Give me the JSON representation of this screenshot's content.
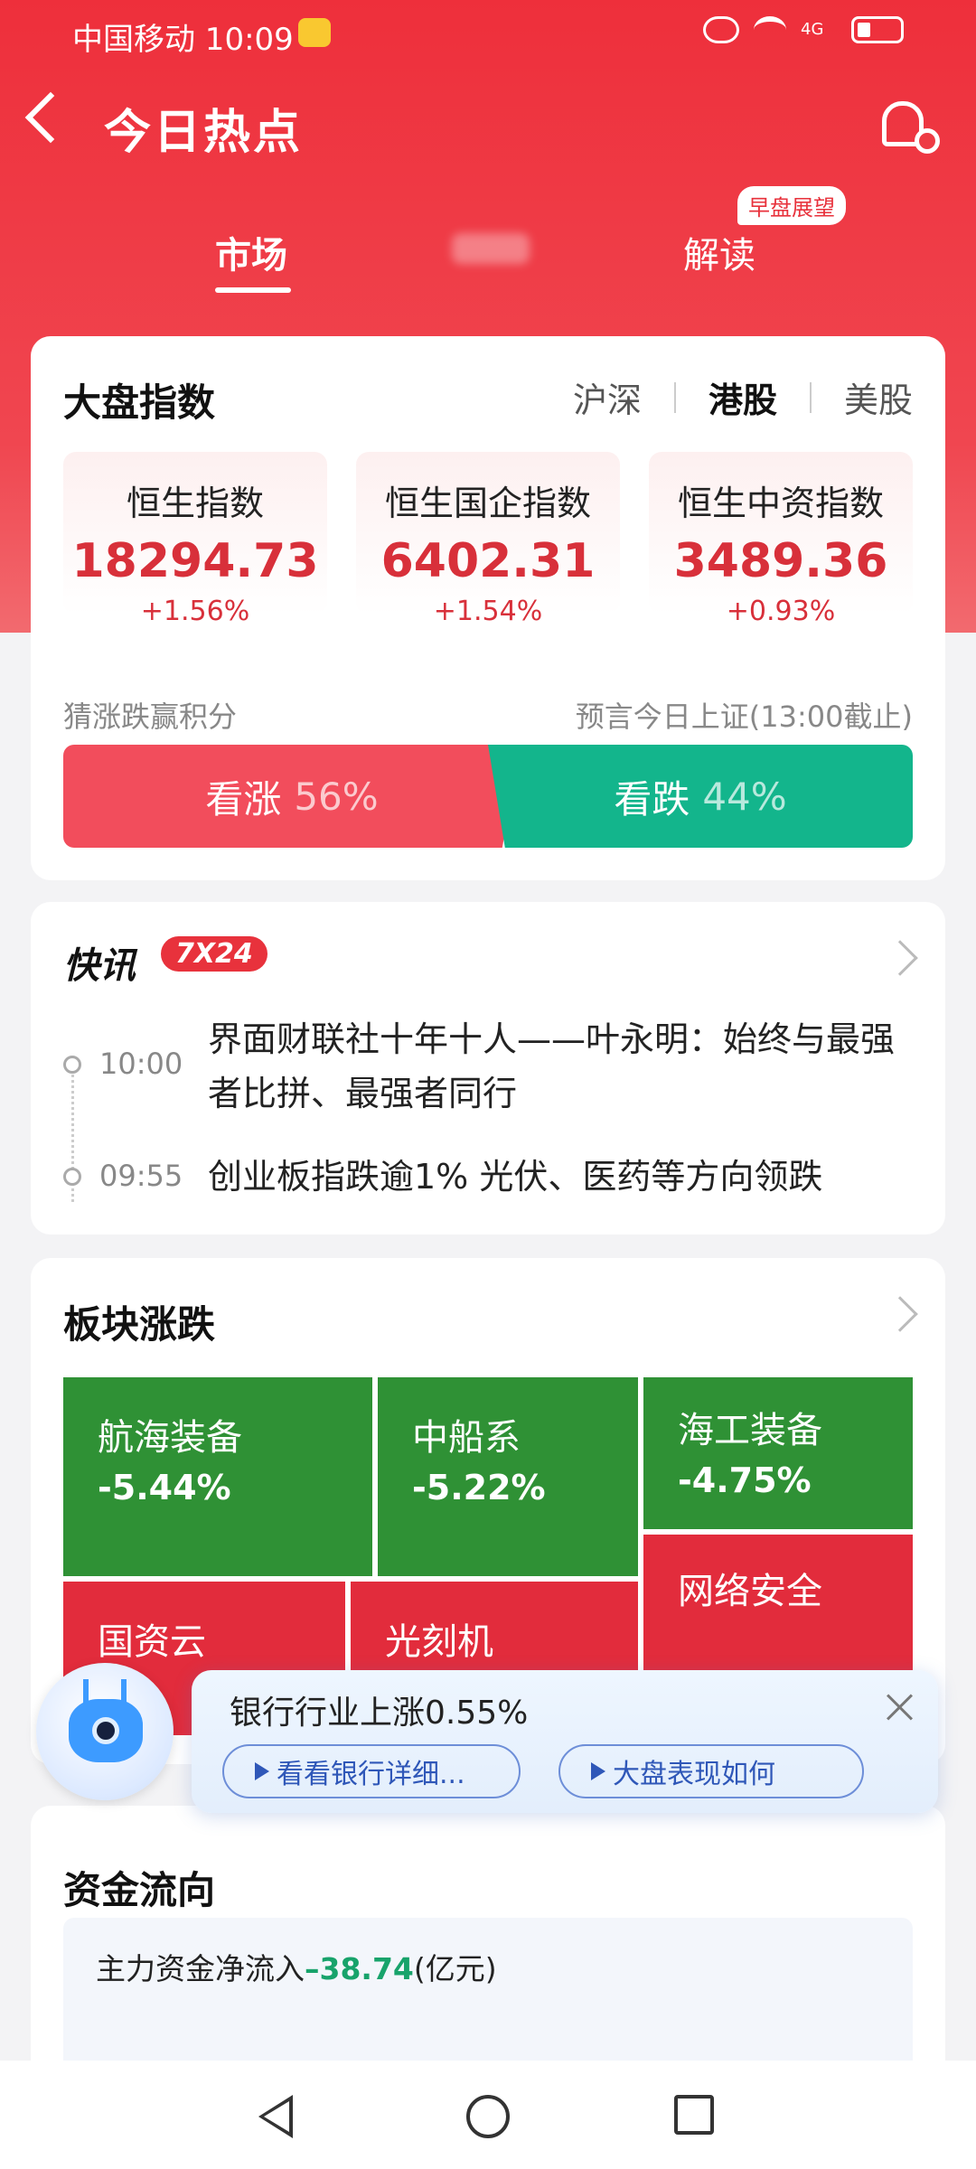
{
  "status_bar": {
    "carrier_time": "中国移动 10:09",
    "network": "4G"
  },
  "header": {
    "title": "今日热点"
  },
  "tabs": [
    {
      "label": "市场"
    },
    {
      "label": ""
    },
    {
      "label": "解读",
      "badge": "早盘展望"
    }
  ],
  "index_card": {
    "title": "大盘指数",
    "segments": [
      "沪深",
      "港股",
      "美股"
    ],
    "active_segment": "港股",
    "indices": [
      {
        "name": "恒生指数",
        "value": "18294.73",
        "change": "+1.56%"
      },
      {
        "name": "恒生国企指数",
        "value": "6402.31",
        "change": "+1.54%"
      },
      {
        "name": "恒生中资指数",
        "value": "3489.36",
        "change": "+0.93%"
      }
    ],
    "guess_left": "猜涨跌赢积分",
    "guess_right": "预言今日上证(13:00截止)",
    "vote_up": {
      "label": "看涨",
      "pct": "56%"
    },
    "vote_down": {
      "label": "看跌",
      "pct": "44%"
    }
  },
  "news_card": {
    "logo": "快讯",
    "tag": "7X24",
    "items": [
      {
        "time": "10:00",
        "text": "界面财联社十年十人——叶永明：始终与最强者比拼、最强者同行"
      },
      {
        "time": "09:55",
        "text": "创业板指跌逾1% 光伏、医药等方向领跌"
      }
    ]
  },
  "sector_card": {
    "title": "板块涨跌",
    "tiles": [
      {
        "name": "航海装备",
        "change": "-5.44%"
      },
      {
        "name": "中船系",
        "change": "-5.22%"
      },
      {
        "name": "海工装备",
        "change": "-4.75%"
      },
      {
        "name": "国资云",
        "change": ""
      },
      {
        "name": "光刻机",
        "change": ""
      },
      {
        "name": "网络安全",
        "change": ""
      }
    ]
  },
  "ai_popup": {
    "title": "银行行业上涨0.55%",
    "buttons": [
      "看看银行详细...",
      "大盘表现如何"
    ]
  },
  "fund_card": {
    "title": "资金流向",
    "label": "主力资金净流入",
    "value": "–38.74",
    "unit": "(亿元)"
  },
  "colors": {
    "brand_red": "#ee2f3b",
    "up_red": "#d8303a",
    "down_green": "#13b58c",
    "sector_green": "#2f9135",
    "sector_red": "#e22c3c"
  }
}
